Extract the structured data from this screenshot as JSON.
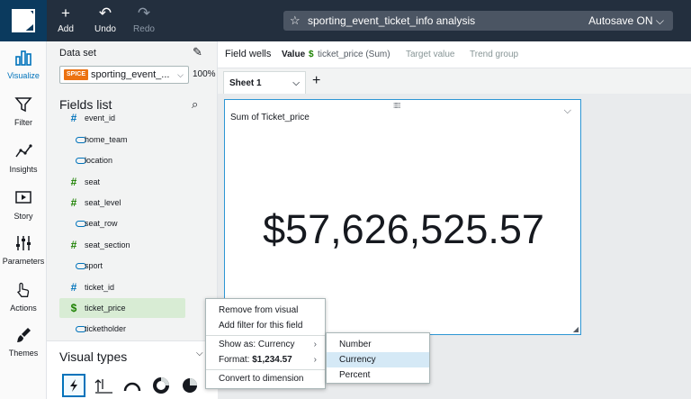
{
  "toolbar": {
    "add_label": "Add",
    "undo_label": "Undo",
    "redo_label": "Redo",
    "analysis_title": "sporting_event_ticket_info analysis",
    "autosave_label": "Autosave ON"
  },
  "nav": {
    "items": [
      {
        "label": "Visualize",
        "icon": "bar-chart-icon",
        "active": true
      },
      {
        "label": "Filter",
        "icon": "filter-icon"
      },
      {
        "label": "Insights",
        "icon": "insights-icon"
      },
      {
        "label": "Story",
        "icon": "story-icon"
      },
      {
        "label": "Parameters",
        "icon": "parameters-icon"
      },
      {
        "label": "Actions",
        "icon": "actions-icon"
      },
      {
        "label": "Themes",
        "icon": "brush-icon"
      }
    ]
  },
  "dataset": {
    "section_label": "Data set",
    "spice_badge": "SPICE",
    "name": "sporting_event_...",
    "usage": "100%"
  },
  "fields": {
    "title": "Fields list",
    "items": [
      {
        "name": "event_id",
        "type": "dimension-number"
      },
      {
        "name": "home_team",
        "type": "dimension"
      },
      {
        "name": "location",
        "type": "dimension"
      },
      {
        "name": "seat",
        "type": "measure"
      },
      {
        "name": "seat_level",
        "type": "measure"
      },
      {
        "name": "seat_row",
        "type": "dimension"
      },
      {
        "name": "seat_section",
        "type": "measure"
      },
      {
        "name": "sport",
        "type": "dimension"
      },
      {
        "name": "ticket_id",
        "type": "dimension-number"
      },
      {
        "name": "ticket_price",
        "type": "currency",
        "selected": true
      },
      {
        "name": "ticketholder",
        "type": "dimension"
      }
    ]
  },
  "visual_types": {
    "title": "Visual types"
  },
  "field_wells": {
    "label": "Field wells",
    "value_label": "Value",
    "value_field": "ticket_price (Sum)",
    "target_label": "Target value",
    "trend_label": "Trend group"
  },
  "sheets": {
    "active": "Sheet 1"
  },
  "visual": {
    "title": "Sum of Ticket_price",
    "kpi_value": "$57,626,525.57"
  },
  "context_menu": {
    "remove": "Remove from visual",
    "add_filter": "Add filter for this field",
    "show_as": "Show as: Currency",
    "format_prefix": "Format: ",
    "format_value": "$1,234.57",
    "convert": "Convert to dimension"
  },
  "submenu": {
    "items": [
      "Number",
      "Currency",
      "Percent"
    ],
    "highlighted": "Currency"
  },
  "colors": {
    "topbar": "#232f3e",
    "accent": "#0073bb",
    "measure_green": "#1d8102",
    "spice_orange": "#ec7211"
  }
}
